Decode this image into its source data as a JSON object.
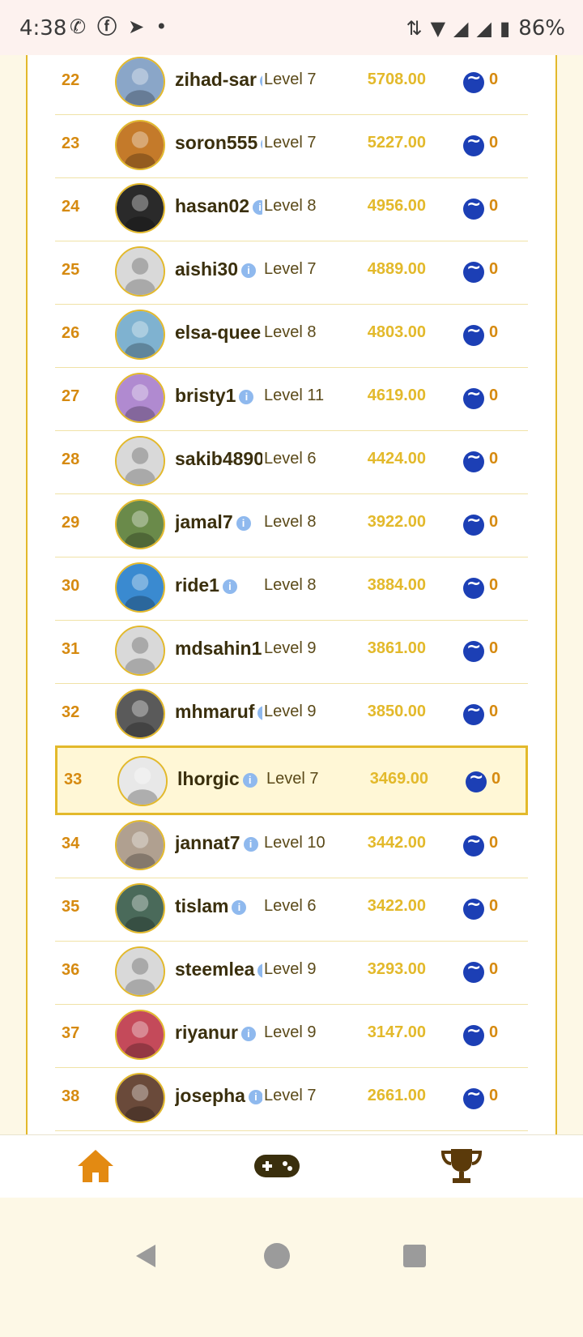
{
  "status": {
    "time": "4:38",
    "battery": "86%",
    "left_icons": [
      "whatsapp-icon",
      "facebook-icon",
      "telegram-icon",
      "dot-icon"
    ],
    "right_icons": [
      "data-arrows-icon",
      "wifi-icon",
      "signal-icon",
      "signal-icon",
      "battery-icon"
    ]
  },
  "leaderboard": {
    "rows": [
      {
        "rank": "22",
        "user": "zihad-sar",
        "level": "Level 7",
        "score": "5708.00",
        "reward": "0"
      },
      {
        "rank": "23",
        "user": "soron555",
        "level": "Level 7",
        "score": "5227.00",
        "reward": "0"
      },
      {
        "rank": "24",
        "user": "hasan02",
        "level": "Level 8",
        "score": "4956.00",
        "reward": "0"
      },
      {
        "rank": "25",
        "user": "aishi30",
        "level": "Level 7",
        "score": "4889.00",
        "reward": "0"
      },
      {
        "rank": "26",
        "user": "elsa-quee",
        "level": "Level 8",
        "score": "4803.00",
        "reward": "0"
      },
      {
        "rank": "27",
        "user": "bristy1",
        "level": "Level 11",
        "score": "4619.00",
        "reward": "0"
      },
      {
        "rank": "28",
        "user": "sakib4890",
        "level": "Level 6",
        "score": "4424.00",
        "reward": "0"
      },
      {
        "rank": "29",
        "user": "jamal7",
        "level": "Level 8",
        "score": "3922.00",
        "reward": "0"
      },
      {
        "rank": "30",
        "user": "ride1",
        "level": "Level 8",
        "score": "3884.00",
        "reward": "0"
      },
      {
        "rank": "31",
        "user": "mdsahin1",
        "level": "Level 9",
        "score": "3861.00",
        "reward": "0"
      },
      {
        "rank": "32",
        "user": "mhmaruf",
        "level": "Level 9",
        "score": "3850.00",
        "reward": "0"
      },
      {
        "rank": "33",
        "user": "lhorgic",
        "level": "Level 7",
        "score": "3469.00",
        "reward": "0",
        "highlight": true
      },
      {
        "rank": "34",
        "user": "jannat7",
        "level": "Level 10",
        "score": "3442.00",
        "reward": "0"
      },
      {
        "rank": "35",
        "user": "tislam",
        "level": "Level 6",
        "score": "3422.00",
        "reward": "0"
      },
      {
        "rank": "36",
        "user": "steemlea",
        "level": "Level 9",
        "score": "3293.00",
        "reward": "0"
      },
      {
        "rank": "37",
        "user": "riyanur",
        "level": "Level 9",
        "score": "3147.00",
        "reward": "0"
      },
      {
        "rank": "38",
        "user": "josepha",
        "level": "Level 7",
        "score": "2661.00",
        "reward": "0"
      }
    ]
  },
  "bottom_nav": {
    "items": [
      {
        "icon": "home-icon",
        "active": true,
        "color": "#e38a12"
      },
      {
        "icon": "gamepad-icon",
        "active": false,
        "color": "#3a2f0d"
      },
      {
        "icon": "trophy-icon",
        "active": false,
        "color": "#5b3a0a"
      }
    ]
  },
  "system_nav": [
    "back-icon",
    "home-circle-icon",
    "recents-icon"
  ],
  "colors": {
    "accent": "#e3b92b",
    "rank": "#d68a10",
    "username": "#3a2f0d",
    "steem": "#1c3fb5"
  }
}
